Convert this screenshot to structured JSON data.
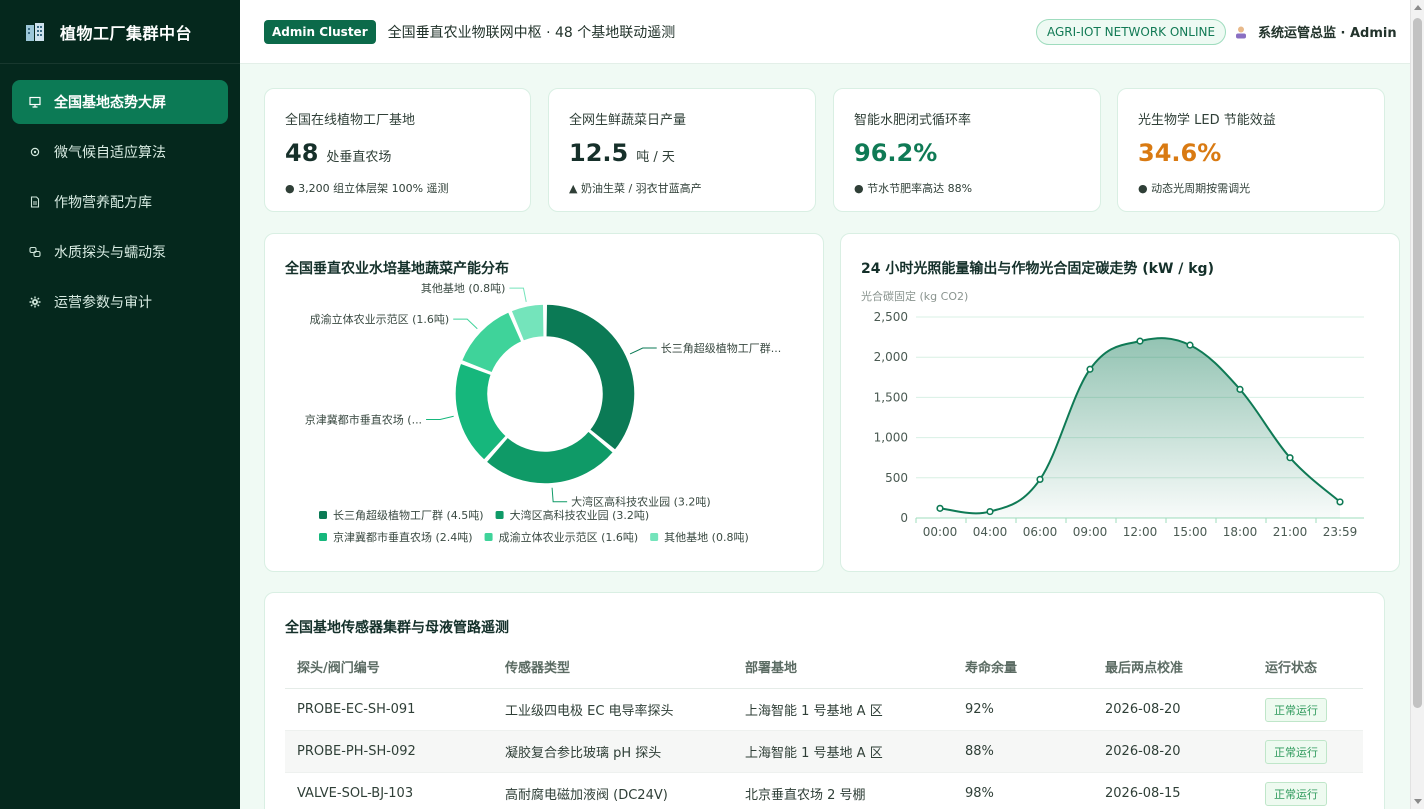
{
  "app": {
    "title": "植物工厂集群中台"
  },
  "sidebar": {
    "items": [
      {
        "label": "全国基地态势大屏",
        "icon": "monitor-icon",
        "active": true
      },
      {
        "label": "微气候自适应算法",
        "icon": "gear-icon",
        "active": false
      },
      {
        "label": "作物营养配方库",
        "icon": "document-icon",
        "active": false
      },
      {
        "label": "水质探头与蠕动泵",
        "icon": "link-icon",
        "active": false
      },
      {
        "label": "运营参数与审计",
        "icon": "cog-icon",
        "active": false
      }
    ]
  },
  "header": {
    "badge": "Admin Cluster",
    "subtitle": "全国垂直农业物联网中枢 · 48 个基地联动遥测",
    "network_status": "AGRI-IOT NETWORK ONLINE",
    "user": "系统运管总监 · Admin"
  },
  "stats": [
    {
      "label": "全国在线植物工厂基地",
      "value": "48",
      "unit": "处垂直农场",
      "note": "● 3,200 组立体层架 100% 遥测",
      "color": "#16302a"
    },
    {
      "label": "全网生鲜蔬菜日产量",
      "value": "12.5",
      "unit": "吨 / 天",
      "note": "▲ 奶油生菜 / 羽衣甘蓝高产",
      "color": "#16302a"
    },
    {
      "label": "智能水肥闭式循环率",
      "value": "96.2%",
      "unit": "",
      "note": "● 节水节肥率高达 88%",
      "color": "#0f7a55"
    },
    {
      "label": "光生物学 LED 节能效益",
      "value": "34.6%",
      "unit": "",
      "note": "● 动态光周期按需调光",
      "color": "#d97a12"
    }
  ],
  "donut": {
    "title": "全国垂直农业水培基地蔬菜产能分布"
  },
  "line": {
    "title": "24 小时光照能量输出与作物光合固定碳走势 (kW / kg)"
  },
  "chart_data": [
    {
      "type": "pie",
      "title": "全国垂直农业水培基地蔬菜产能分布",
      "unit": "吨",
      "series": [
        {
          "name": "长三角超级植物工厂群",
          "value": 4.5,
          "callout": "长三角超级植物工厂群...",
          "legend": "长三角超级植物工厂群 (4.5吨)",
          "color": "#0b7a55"
        },
        {
          "name": "大湾区高科技农业园",
          "value": 3.2,
          "callout": "大湾区高科技农业园 (3.2吨)",
          "legend": "大湾区高科技农业园 (3.2吨)",
          "color": "#0f9a67"
        },
        {
          "name": "京津冀都市垂直农场",
          "value": 2.4,
          "callout": "京津冀都市垂直农场 (...",
          "legend": "京津冀都市垂直农场 (2.4吨)",
          "color": "#16b77c"
        },
        {
          "name": "成渝立体农业示范区",
          "value": 1.6,
          "callout": "成渝立体农业示范区 (1.6吨)",
          "legend": "成渝立体农业示范区 (1.6吨)",
          "color": "#3fd39a"
        },
        {
          "name": "其他基地",
          "value": 0.8,
          "callout": "其他基地 (0.8吨)",
          "legend": "其他基地 (0.8吨)",
          "color": "#74e4bb"
        }
      ],
      "legend_position": "bottom"
    },
    {
      "type": "area",
      "title": "24 小时光照能量输出与作物光合固定碳走势 (kW / kg)",
      "ylabel": "光合碳固定 (kg CO2)",
      "categories": [
        "00:00",
        "04:00",
        "06:00",
        "09:00",
        "12:00",
        "15:00",
        "18:00",
        "21:00",
        "23:59"
      ],
      "values": [
        120,
        80,
        480,
        1850,
        2200,
        2150,
        1600,
        750,
        200
      ],
      "ylim": [
        0,
        2500
      ],
      "yticks": [
        "2,500",
        "2,000",
        "1,500",
        "1,000",
        "500",
        "0"
      ],
      "grid": true,
      "color": "#0f7a55"
    }
  ],
  "table": {
    "title": "全国基地传感器集群与母液管路遥测",
    "columns": [
      "探头/阀门编号",
      "传感器类型",
      "部署基地",
      "寿命余量",
      "最后两点校准",
      "运行状态"
    ],
    "rows": [
      [
        "PROBE-EC-SH-091",
        "工业级四电极 EC 电导率探头",
        "上海智能 1 号基地 A 区",
        "92%",
        "2026-08-20",
        "正常运行"
      ],
      [
        "PROBE-PH-SH-092",
        "凝胶复合参比玻璃 pH 探头",
        "上海智能 1 号基地 A 区",
        "88%",
        "2026-08-20",
        "正常运行"
      ],
      [
        "VALVE-SOL-BJ-103",
        "高耐腐电磁加液阀 (DC24V)",
        "北京垂直农场 2 号棚",
        "98%",
        "2026-08-15",
        "正常运行"
      ]
    ]
  }
}
